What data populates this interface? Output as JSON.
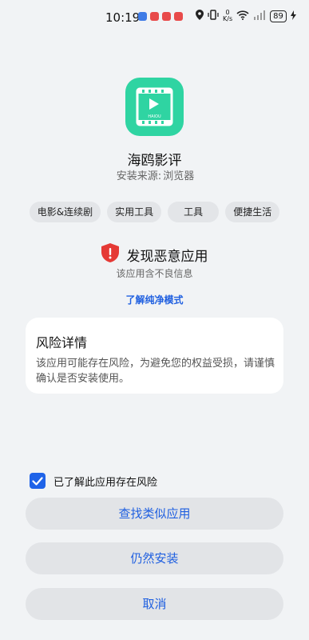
{
  "status_bar": {
    "time": "10:19",
    "network_speed_value": "0",
    "network_speed_unit": "K/s",
    "battery": "89"
  },
  "app": {
    "name": "海鸥影评",
    "source_label": "安装来源:",
    "source_value": "浏览器",
    "icon_text": "HAIOU",
    "icon_color": "#2fd4a2"
  },
  "tags": [
    "电影&连续剧",
    "实用工具",
    "工具",
    "便捷生活"
  ],
  "warning": {
    "title": "发现恶意应用",
    "subtitle": "该应用含不良信息",
    "link": "了解纯净模式",
    "icon_color": "#e53935"
  },
  "risk_card": {
    "title": "风险详情",
    "body": "该应用可能存在风险，为避免您的权益受损，请谨慎确认是否安装使用。"
  },
  "consent": {
    "label": "已了解此应用存在风险",
    "checked": true
  },
  "buttons": {
    "find_similar": "查找类似应用",
    "install_anyway": "仍然安装",
    "cancel": "取消"
  },
  "colors": {
    "accent": "#1f5fe0",
    "background": "#f1f3f5"
  }
}
